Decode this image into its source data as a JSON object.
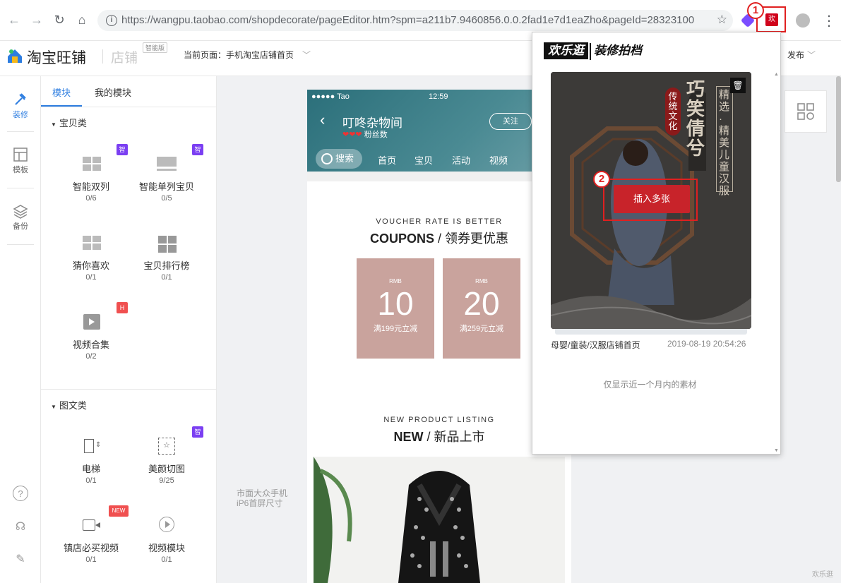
{
  "browser": {
    "url": "https://wangpu.taobao.com/shopdecorate/pageEditor.htm?spm=a211b7.9460856.0.0.2fad1e7d1eaZho&pageId=28323100",
    "info_icon": "i",
    "annotation_1": "1",
    "annotation_2": "2",
    "extension_label": "欢"
  },
  "header": {
    "logo_text": "淘宝旺铺",
    "logo_shop": "店铺",
    "logo_tag": "智能版",
    "current_page_label": "当前页面：",
    "current_page_value": "手机淘宝店铺首页",
    "publish_label": "发布"
  },
  "rail": {
    "items": [
      {
        "label": "装修"
      },
      {
        "label": "模板"
      },
      {
        "label": "备份"
      }
    ]
  },
  "panel": {
    "tabs": [
      {
        "label": "模块"
      },
      {
        "label": "我的模块"
      }
    ],
    "section1_title": "宝贝类",
    "section2_title": "图文类",
    "tag_smart": "智",
    "tag_h": "H",
    "tag_new": "NEW",
    "modules": [
      {
        "name": "智能双列",
        "count": "0/6"
      },
      {
        "name": "智能单列宝贝",
        "count": "0/5"
      },
      {
        "name": "猜你喜欢",
        "count": "0/1"
      },
      {
        "name": "宝贝排行榜",
        "count": "0/1"
      },
      {
        "name": "视频合集",
        "count": "0/2"
      },
      {
        "name": "电梯",
        "count": "0/1"
      },
      {
        "name": "美颜切图",
        "count": "9/25"
      },
      {
        "name": "镇店必买视频",
        "count": "0/1"
      },
      {
        "name": "视频模块",
        "count": "0/1"
      }
    ]
  },
  "phone": {
    "carrier": "●●●●● Tao",
    "time": "12:59",
    "shop_name": "叮咚杂物间",
    "fans": "粉丝数",
    "follow": "关注",
    "search": "搜索",
    "nav": [
      "首页",
      "宝贝",
      "活动",
      "视频"
    ],
    "coupons_en": "VOUCHER RATE IS BETTER",
    "coupons_cn_bold": "COUPONS",
    "coupons_cn_rest": "/ 领券更优惠",
    "coupons": [
      {
        "currency": "RMB",
        "amount": "10",
        "condition": "满199元立减"
      },
      {
        "currency": "RMB",
        "amount": "20",
        "condition": "满259元立减"
      }
    ],
    "new_en": "NEW PRODUCT LISTING",
    "new_cn_bold": "NEW",
    "new_cn_rest": "/ 新品上市"
  },
  "canvas": {
    "note_line1": "市面大众手机",
    "note_line2": "iP6首屏尺寸",
    "watermark": "欢乐逛"
  },
  "popup": {
    "logo_part1": "欢乐逛",
    "logo_part2": "装修拍档",
    "card_vertical_text": "精选·精美儿童汉服",
    "card_badge": "传统文化",
    "card_big": "巧笑倩兮",
    "insert_button": "插入多张",
    "card_title": "母婴/童装/汉服店铺首页",
    "card_time": "2019-08-19 20:54:26",
    "note": "仅显示近一个月内的素材"
  }
}
